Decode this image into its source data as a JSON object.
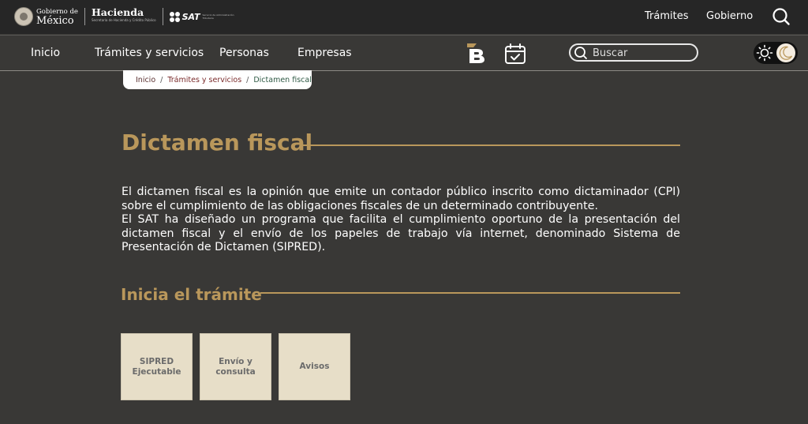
{
  "header": {
    "gob_line1": "Gobierno de",
    "gob_line2": "México",
    "hacienda": "Hacienda",
    "hacienda_sub": "Secretaría de Hacienda y Crédito Público",
    "sat": "SAT",
    "sat_sub": "Servicio de Administración Tributaria",
    "links": [
      "Trámites",
      "Gobierno"
    ]
  },
  "nav": {
    "items": [
      "Inicio",
      "Trámites y servicios",
      "Personas",
      "Empresas"
    ],
    "search_placeholder": "Buscar"
  },
  "breadcrumb": {
    "items": [
      "Inicio",
      "Trámites y servicios",
      "Dictamen fiscal"
    ],
    "separator": "/"
  },
  "page": {
    "title": "Dictamen fiscal",
    "paragraphs": [
      "El dictamen fiscal es la opinión que emite un contador público inscrito como dictaminador (CPI) sobre el cumplimiento de las obligaciones fiscales de un determinado contribuyente.",
      "El SAT ha diseñado un programa que facilita el cumplimiento oportuno de la presentación del dictamen fiscal y el envío de los papeles de trabajo vía internet, denominado Sistema de Presentación de Dictamen (SIPRED)."
    ],
    "subtitle": "Inicia el trámite",
    "cards": [
      "SIPRED Ejecutable",
      "Envío y consulta",
      "Avisos"
    ]
  },
  "colors": {
    "accent": "#b9975b",
    "background": "#393836",
    "topbar": "#262626",
    "card": "#e7dec8"
  },
  "icons": [
    "search-icon",
    "b-logo-icon",
    "calendar-check-icon",
    "sun-icon",
    "moon-icon"
  ]
}
